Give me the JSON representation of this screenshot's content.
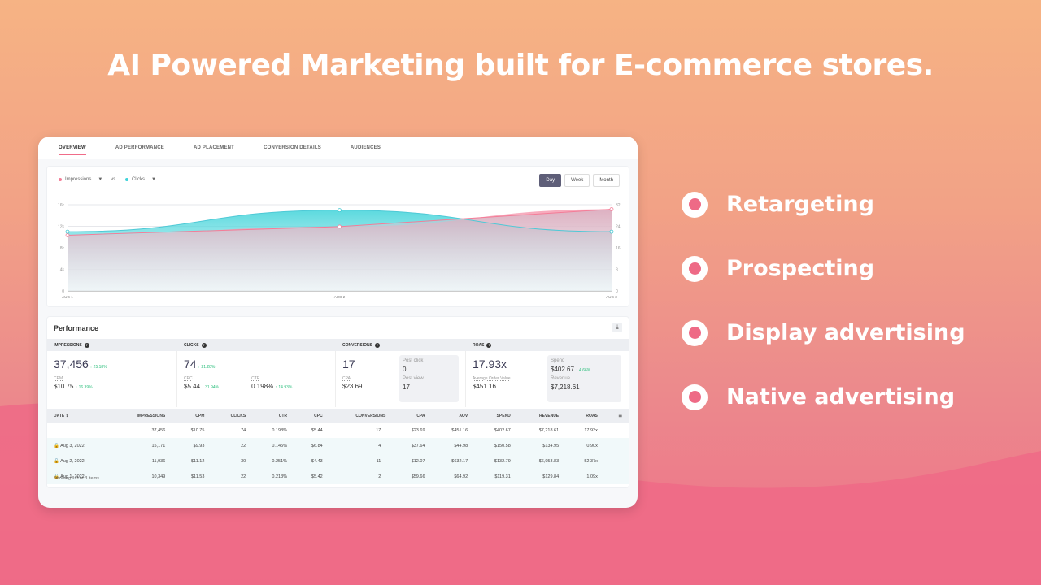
{
  "headline": "AI Powered Marketing built for E-commerce stores.",
  "features": [
    "Retargeting",
    "Prospecting",
    "Display advertising",
    "Native advertising"
  ],
  "tabs": [
    "OVERVIEW",
    "AD PERFORMANCE",
    "AD PLACEMENT",
    "CONVERSION DETAILS",
    "AUDIENCES"
  ],
  "active_tab": "OVERVIEW",
  "chart": {
    "metric_a": "Impressions",
    "vs": "vs.",
    "metric_b": "Clicks",
    "ranges": [
      "Day",
      "Week",
      "Month"
    ],
    "selected_range": "Day"
  },
  "chart_data": {
    "type": "area",
    "categories": [
      "AUG 1",
      "AUG 2",
      "AUG 3"
    ],
    "left_axis": {
      "ticks": [
        "0",
        "4k",
        "8k",
        "12k",
        "16k"
      ],
      "range": [
        0,
        16000
      ]
    },
    "right_axis": {
      "ticks": [
        "0",
        "8",
        "16",
        "24",
        "32"
      ],
      "range": [
        0,
        32
      ]
    },
    "series": [
      {
        "name": "Impressions",
        "axis": "left",
        "values": [
          10349,
          11936,
          15171
        ],
        "color": "#f47c97"
      },
      {
        "name": "Clicks",
        "axis": "right",
        "values": [
          22,
          30,
          22
        ],
        "color": "#3fd3d9"
      }
    ],
    "grid": true,
    "legend": "top-left"
  },
  "performance": {
    "title": "Performance",
    "impressions": {
      "label": "IMPRESSIONS",
      "value": "37,456",
      "change": "↑ 25.18%",
      "cpm_label": "CPM",
      "cpm": "$10.75",
      "cpm_change": "↓ 16.39%"
    },
    "clicks": {
      "label": "CLICKS",
      "value": "74",
      "change": "↑ 21.28%",
      "cpc_label": "CPC",
      "cpc": "$5.44",
      "cpc_change": "↓ 31.94%",
      "ctr_label": "CTR",
      "ctr": "0.198%",
      "ctr_change": "↑ 14.93%"
    },
    "conversions": {
      "label": "CONVERSIONS",
      "value": "17",
      "cpa_label": "CPA",
      "cpa": "$23.69",
      "post_click_label": "Post click",
      "post_click": "0",
      "post_view_label": "Post view",
      "post_view": "17"
    },
    "roas": {
      "label": "ROAS",
      "value": "17.93x",
      "aov_label": "Average Order Value",
      "aov": "$451.16",
      "spend_label": "Spend",
      "spend": "$402.67",
      "spend_change": "↑ 4.66%",
      "revenue_label": "Revenue",
      "revenue": "$7,218.61"
    }
  },
  "table": {
    "headers": [
      "DATE",
      "IMPRESSIONS",
      "CPM",
      "CLICKS",
      "CTR",
      "CPC",
      "CONVERSIONS",
      "CPA",
      "AOV",
      "SPEND",
      "REVENUE",
      "ROAS"
    ],
    "totals": [
      "",
      "37,456",
      "$10.75",
      "74",
      "0.198%",
      "$5.44",
      "17",
      "$23.69",
      "$451.16",
      "$402.67",
      "$7,218.61",
      "17.93x"
    ],
    "rows": [
      [
        "Aug 3, 2022",
        "15,171",
        "$9.93",
        "22",
        "0.145%",
        "$6.84",
        "4",
        "$37.64",
        "$44.98",
        "$150.58",
        "$134.95",
        "0.90x"
      ],
      [
        "Aug 2, 2022",
        "11,936",
        "$11.12",
        "30",
        "0.251%",
        "$4.43",
        "11",
        "$12.07",
        "$632.17",
        "$132.79",
        "$6,953.83",
        "52.37x"
      ],
      [
        "Aug 1, 2022",
        "10,349",
        "$11.53",
        "22",
        "0.213%",
        "$5.42",
        "2",
        "$59.66",
        "$64.92",
        "$119.31",
        "$129.84",
        "1.09x"
      ]
    ],
    "footer": "Showing 1-3 of 3 items"
  }
}
